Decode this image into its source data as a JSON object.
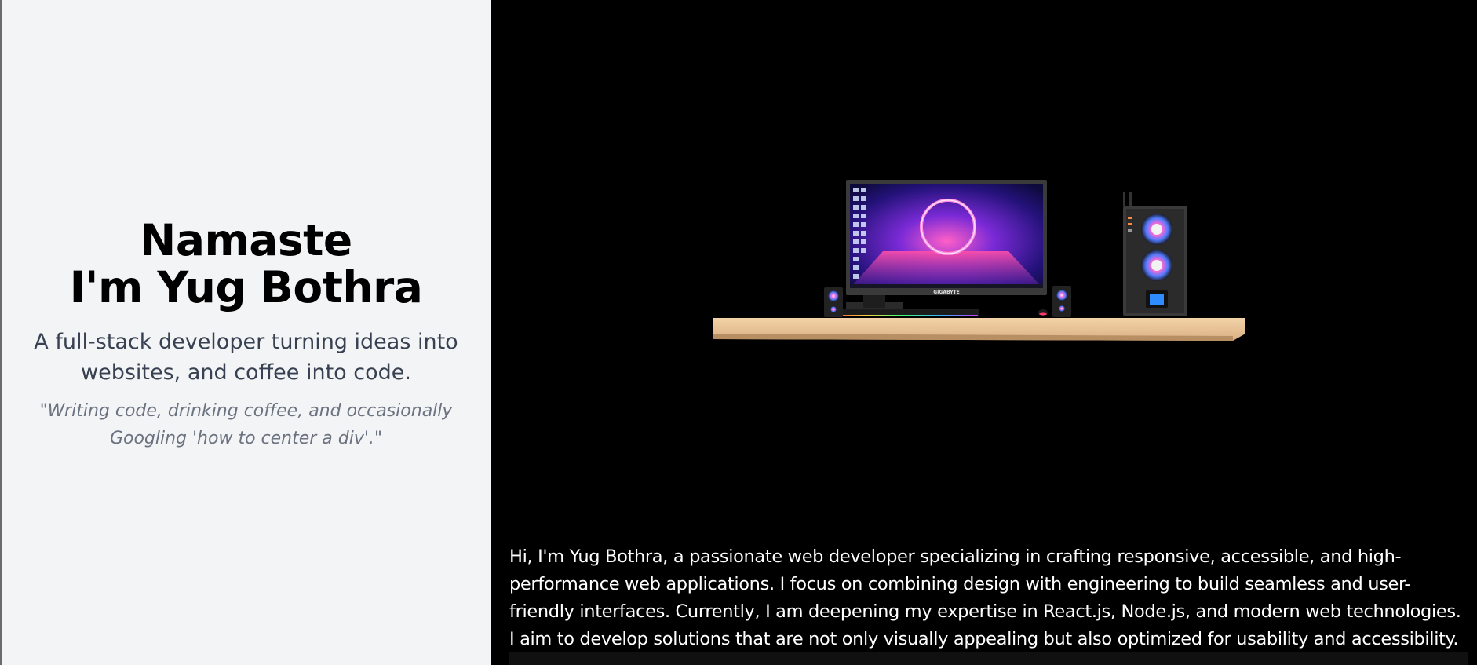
{
  "hero": {
    "greeting": "Namaste",
    "name_line": "I'm Yug Bothra",
    "tagline": "A full-stack developer turning ideas into websites, and coffee into code.",
    "quote": "\"Writing code, drinking coffee, and occasionally Googling 'how to center a div'.\""
  },
  "scene": {
    "monitor_brand": "GIGABYTE",
    "colors": {
      "shelf": "#e8c497",
      "background": "#000000",
      "screen_glow": "#ff3fa0",
      "accent_blue": "#4f7bff"
    }
  },
  "about": {
    "text": "Hi, I'm Yug Bothra, a passionate web developer specializing in crafting responsive, accessible, and high-performance web applications. I focus on combining design with engineering to build seamless and user-friendly interfaces. Currently, I am deepening my expertise in React.js, Node.js, and modern web technologies. I aim to develop solutions that are not only visually appealing but also optimized for usability and accessibility."
  }
}
